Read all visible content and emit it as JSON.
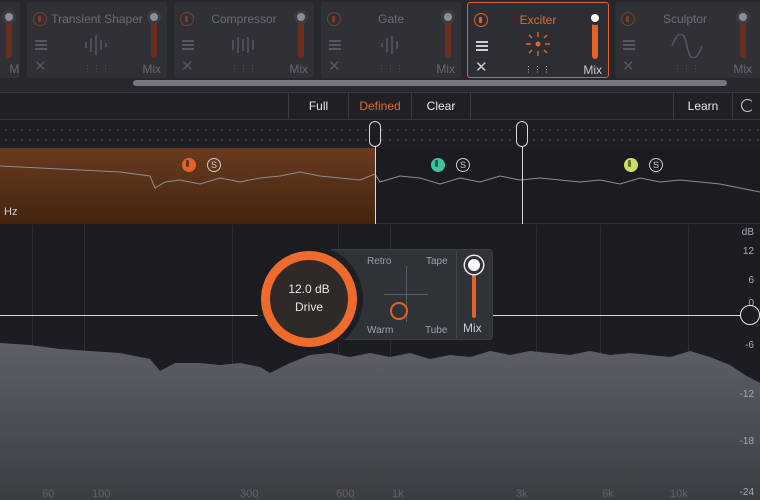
{
  "modules": [
    {
      "title": "Transient Shaper",
      "mix": "Mix",
      "active": false
    },
    {
      "title": "Compressor",
      "mix": "Mix",
      "active": false
    },
    {
      "title": "Gate",
      "mix": "Mix",
      "active": false
    },
    {
      "title": "Exciter",
      "mix": "Mix",
      "active": true
    },
    {
      "title": "Sculptor",
      "mix": "Mix",
      "active": false
    }
  ],
  "first_module_mix": "Mix",
  "toolbar": {
    "full": "Full",
    "defined": "Defined",
    "clear": "Clear",
    "learn": "Learn",
    "selected": "Defined"
  },
  "bands": {
    "hz_label": "Hz",
    "solo_label": "S",
    "band_colors": [
      "#e2622a",
      "#3fc3a0",
      "#c8e05a"
    ]
  },
  "spectrum": {
    "db_unit": "dB",
    "db_scale": [
      "12",
      "6",
      "0",
      "-6",
      "-12",
      "-18",
      "-24"
    ],
    "freq_labels": [
      "60",
      "100",
      "300",
      "600",
      "1k",
      "3k",
      "6k",
      "10k"
    ]
  },
  "drive": {
    "value": "12.0 dB",
    "label": "Drive",
    "modes": {
      "retro": "Retro",
      "tape": "Tape",
      "warm": "Warm",
      "tube": "Tube"
    },
    "mix_label": "Mix"
  },
  "colors": {
    "accent": "#e2622a",
    "panel": "#2f3136",
    "background": "#1b1d22"
  },
  "icons": [
    "power-icon",
    "list-icon",
    "close-icon",
    "grid-icon",
    "reset-icon",
    "solo-icon"
  ]
}
